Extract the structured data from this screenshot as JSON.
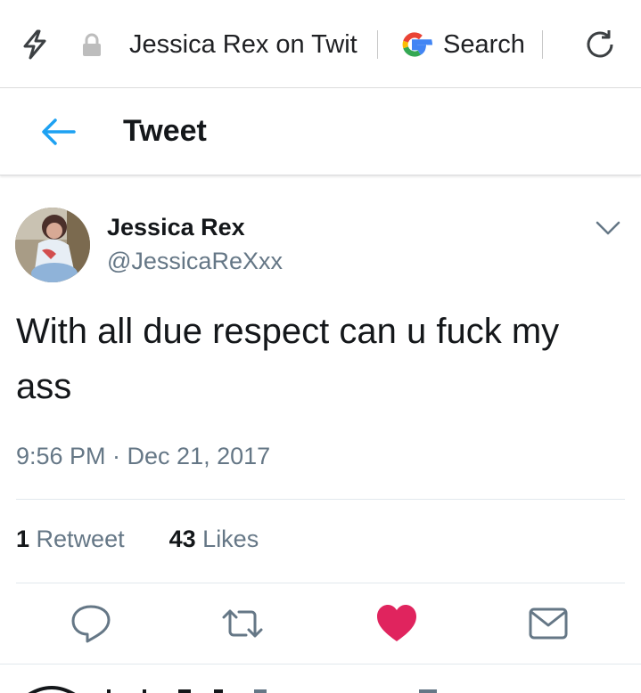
{
  "browser": {
    "url_title": "Jessica Rex on Twit",
    "search_label": "Search"
  },
  "header": {
    "title": "Tweet"
  },
  "tweet": {
    "display_name": "Jessica Rex",
    "handle": "@JessicaReXxx",
    "text": "With all due respect can u fuck my ass",
    "timestamp": "9:56 PM · Dec 21, 2017",
    "retweets": {
      "count": "1",
      "label": "Retweet"
    },
    "likes": {
      "count": "43",
      "label": "Likes"
    },
    "liked": true
  },
  "colors": {
    "accent": "#1da1f2",
    "like": "#e0245e",
    "icon_gray": "#657786",
    "text": "#14171a"
  },
  "icons": [
    "bolt-icon",
    "lock-icon",
    "google-icon",
    "reload-icon",
    "back-arrow-icon",
    "chevron-down-icon",
    "reply-icon",
    "retweet-icon",
    "heart-icon",
    "message-icon"
  ]
}
